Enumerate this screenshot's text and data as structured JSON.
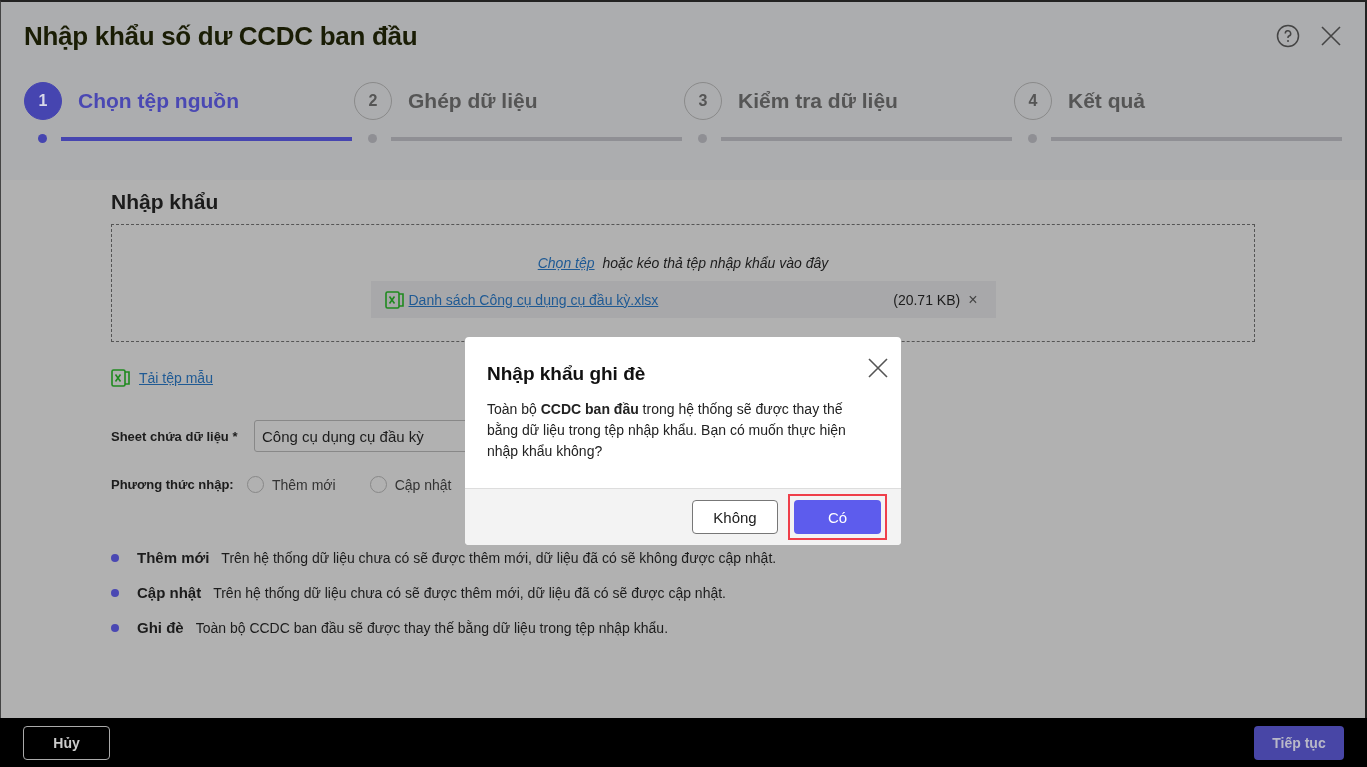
{
  "window": {
    "title": "Nhập khẩu số dư CCDC ban đầu"
  },
  "steps": [
    {
      "number": "1",
      "label": "Chọn tệp nguồn",
      "selected": true
    },
    {
      "number": "2",
      "label": "Ghép dữ liệu",
      "selected": false
    },
    {
      "number": "3",
      "label": "Kiểm tra dữ liệu",
      "selected": false
    },
    {
      "number": "4",
      "label": "Kết quả",
      "selected": false
    }
  ],
  "import": {
    "heading": "Nhập khẩu",
    "choose_link": "Chọn tệp",
    "drop_hint": "hoặc kéo thả tệp nhập khẩu vào đây",
    "file": {
      "name": "Danh sách Công cụ dụng cụ đầu kỳ.xlsx",
      "size": "(20.71 KB)",
      "remove": "×"
    },
    "template_link": "Tải tệp mẫu"
  },
  "sheet": {
    "label": "Sheet chứa dữ liệu *",
    "value": "Công cụ dụng cụ đầu kỳ"
  },
  "method": {
    "label": "Phương thức nhập:",
    "options": [
      {
        "label": "Thêm mới",
        "selected": false
      },
      {
        "label": "Cập nhật",
        "selected": false
      }
    ]
  },
  "notes": [
    {
      "term": "Thêm mới",
      "text": "Trên hệ thống dữ liệu chưa có sẽ được thêm mới, dữ liệu đã có sẽ không được cập nhật."
    },
    {
      "term": "Cập nhật",
      "text": "Trên hệ thống dữ liệu chưa có sẽ được thêm mới, dữ liệu đã có sẽ được cập nhật."
    },
    {
      "term": "Ghi đè",
      "text": "Toàn bộ CCDC ban đầu sẽ được thay thế bằng dữ liệu trong tệp nhập khẩu."
    }
  ],
  "footer": {
    "cancel": "Hủy",
    "next": "Tiếp tục"
  },
  "dialog": {
    "title": "Nhập khẩu ghi đè",
    "message": "Toàn bộ **CCDC ban đầu** trong hệ thống sẽ được thay thế bằng dữ liệu trong tệp nhập khẩu. Bạn có muốn thực hiện nhập khẩu không?",
    "buttons": [
      {
        "label": "Không",
        "kind": "secondary",
        "highlighted": false
      },
      {
        "label": "Có",
        "kind": "primary",
        "highlighted": true
      }
    ]
  }
}
